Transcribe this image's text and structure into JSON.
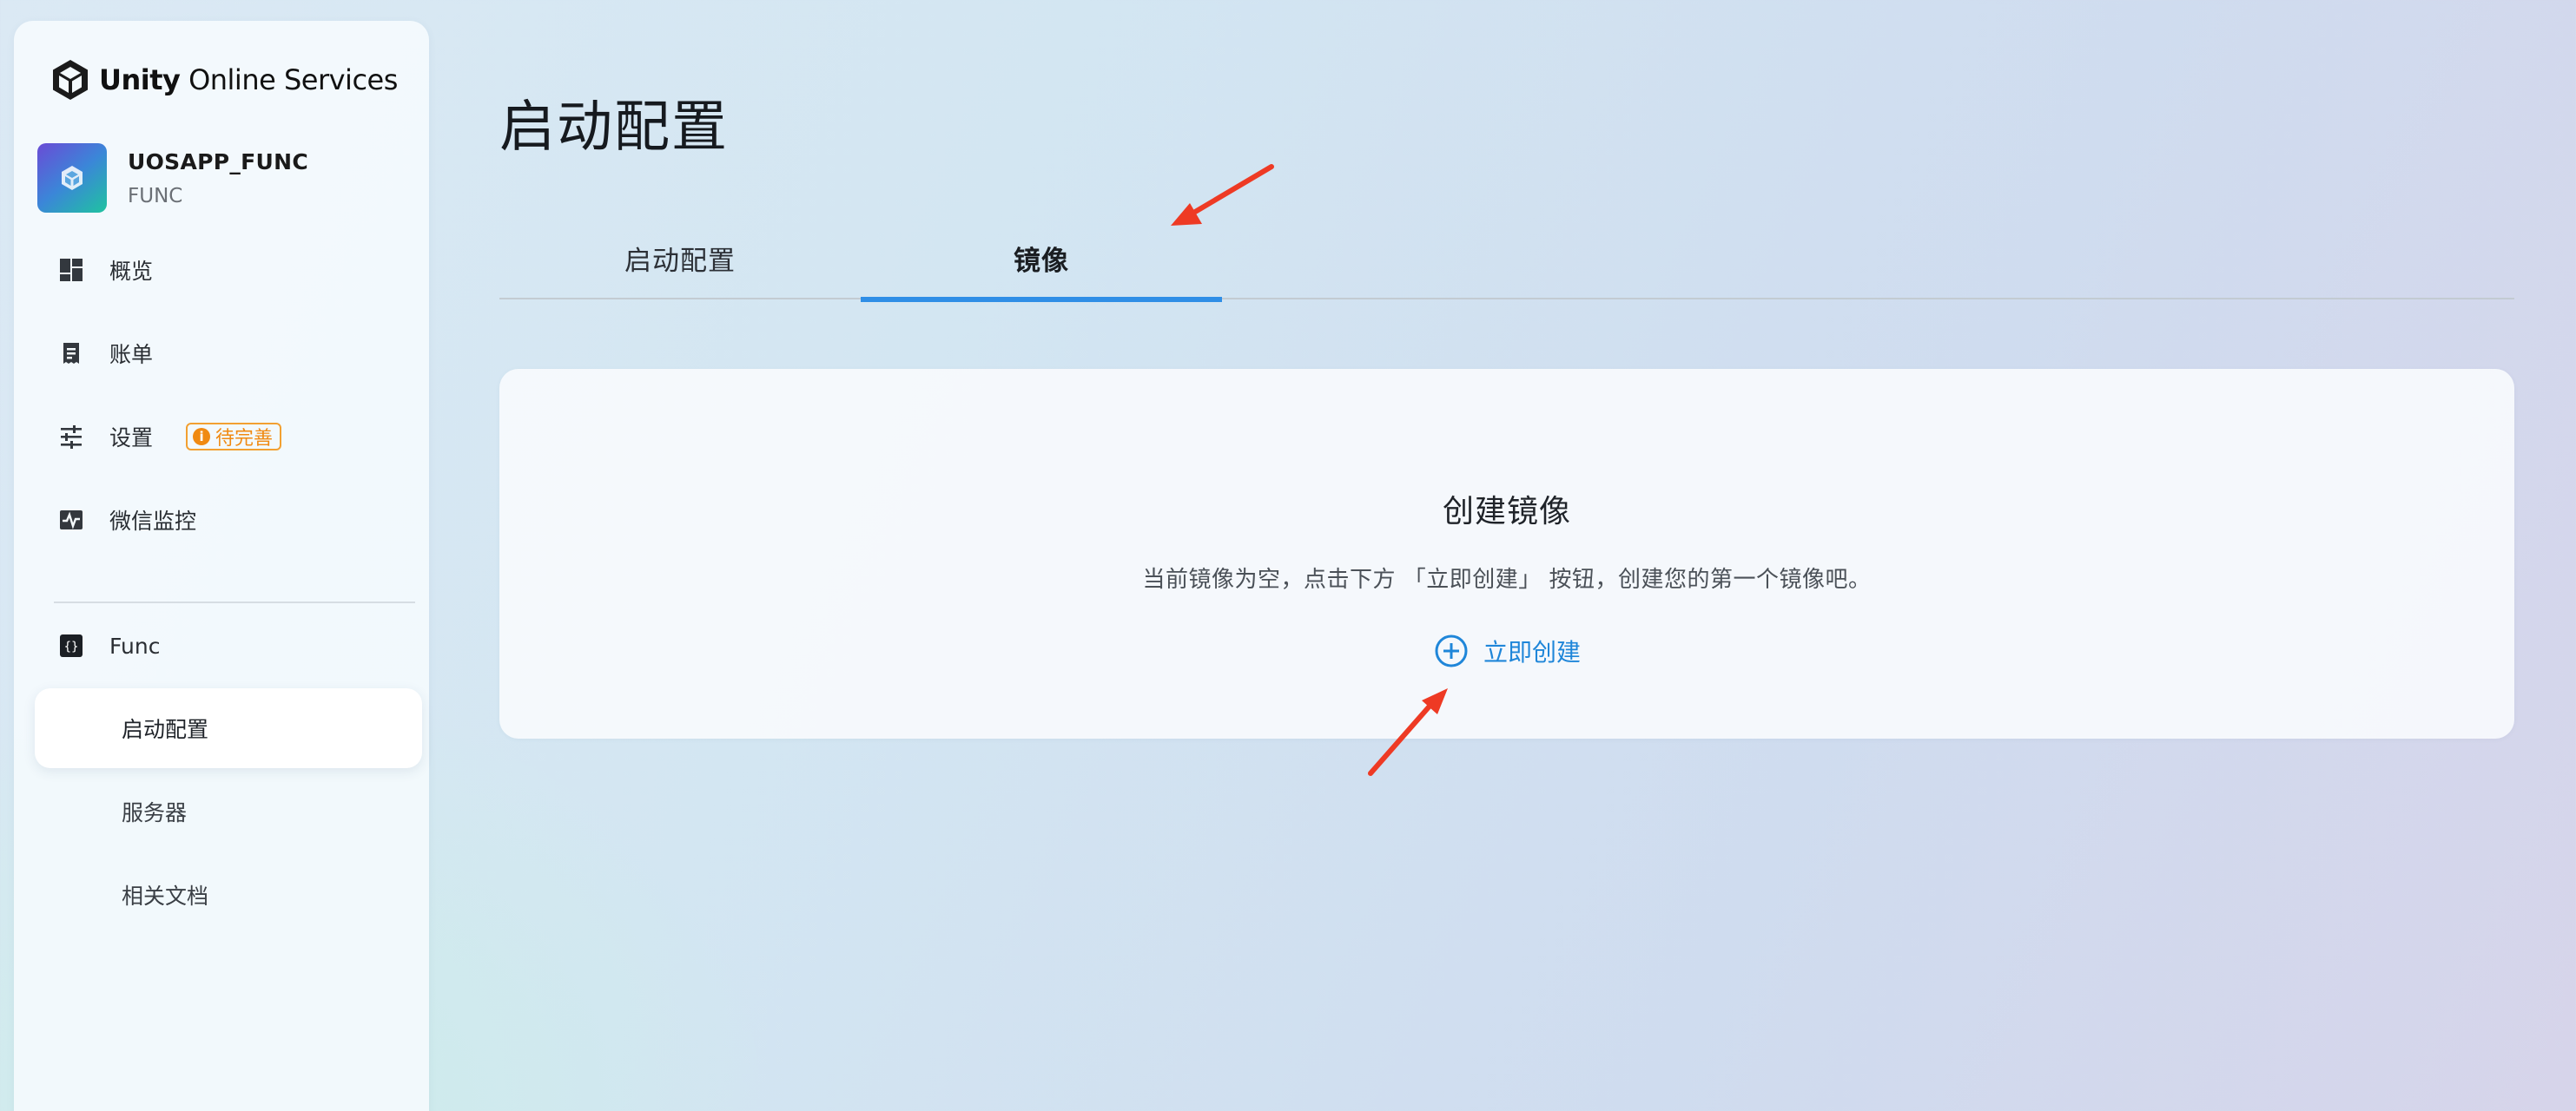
{
  "brand": {
    "name_bold": "Unity",
    "name_rest": " Online Services"
  },
  "project": {
    "name": "UOSAPP_FUNC",
    "sub": "FUNC"
  },
  "nav": {
    "overview": "概览",
    "billing": "账单",
    "settings": "设置",
    "settings_badge": "待完善",
    "wechat_monitor": "微信监控",
    "func": "Func",
    "sub_items": [
      "启动配置",
      "服务器",
      "相关文档"
    ]
  },
  "page": {
    "title": "启动配置"
  },
  "tabs": [
    "启动配置",
    "镜像"
  ],
  "active_tab": "镜像",
  "card": {
    "title": "创建镜像",
    "description": "当前镜像为空，点击下方 「立即创建」 按钮，创建您的第一个镜像吧。",
    "create_label": "立即创建"
  },
  "colors": {
    "accent": "#2f8ee6",
    "badge": "#f08a12",
    "annotation_arrow": "#ee3a24"
  },
  "icons": {
    "overview": "dashboard-icon",
    "billing": "receipt-icon",
    "settings": "sliders-icon",
    "wechat_monitor": "pulse-icon",
    "func": "braces-icon",
    "create": "plus-circle-icon"
  }
}
